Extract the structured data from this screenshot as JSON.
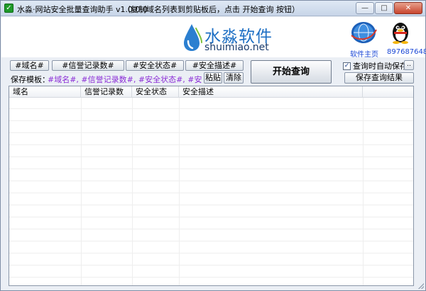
{
  "window": {
    "title": "水淼·网站安全批量查询助手 v1.0.0.0",
    "hint": "（复制域名列表到剪贴板后，点击 开始查询 按钮）",
    "minimize_glyph": "—",
    "maximize_glyph": "□",
    "close_glyph": "✕"
  },
  "brand": {
    "title": "水淼软件",
    "url": "shuimiao.net",
    "home_label": "软件主页",
    "qq_number": "897687648"
  },
  "tags": {
    "domain": "#域名#",
    "credit": "#信誉记录数#",
    "status": "#安全状态#",
    "desc": "#安全描述#"
  },
  "template": {
    "label": "保存模板：",
    "value": "#域名#, #信誉记录数#, #安全状态#, #安全描述#",
    "paste_label": "粘贴",
    "clear_label": "清除"
  },
  "actions": {
    "start_label": "开始查询",
    "autosave_label": "查询时自动保存",
    "autosave_checked": true,
    "dots_label": "..",
    "save_results_label": "保存查询结果"
  },
  "table": {
    "columns": [
      "域名",
      "信誉记录数",
      "安全状态",
      "安全描述"
    ],
    "rows": []
  },
  "colors": {
    "brand_blue": "#1d6fc4",
    "template_purple": "#8a2bd6",
    "link_blue": "#1a47d6"
  },
  "icons": {
    "app": "shield-check-icon",
    "brand": "water-drop-icon",
    "home": "globe-icon",
    "qq": "qq-penguin-icon"
  }
}
